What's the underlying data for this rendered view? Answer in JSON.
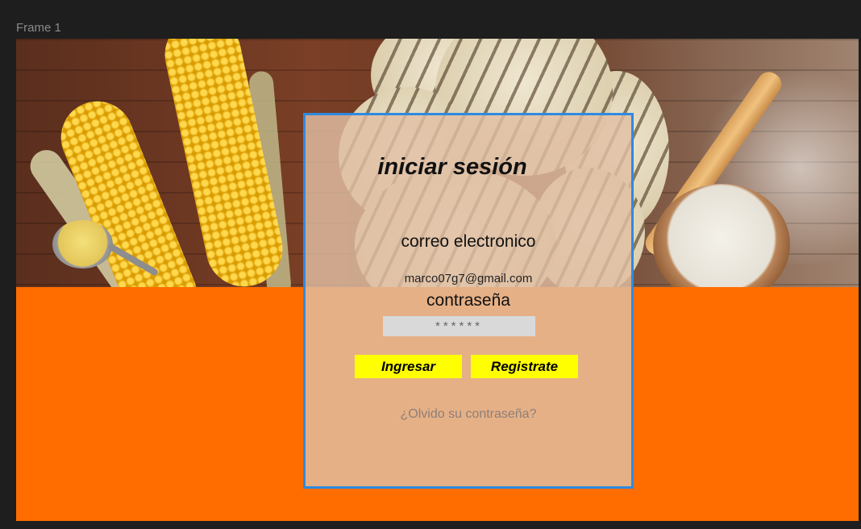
{
  "frame": {
    "label": "Frame 1"
  },
  "colors": {
    "background": "#1e1e1e",
    "accent_orange": "#ff6d00",
    "panel_border": "#2f8ae0",
    "button_yellow": "#ffff00"
  },
  "login": {
    "title": "iniciar sesión",
    "email_label": "correo electronico",
    "email_value": "marco07g7@gmail.com",
    "password_label": "contraseña",
    "password_value": "******",
    "login_button": "Ingresar",
    "register_button": "Registrate",
    "forgot_link": "¿Olvido su contraseña?"
  }
}
